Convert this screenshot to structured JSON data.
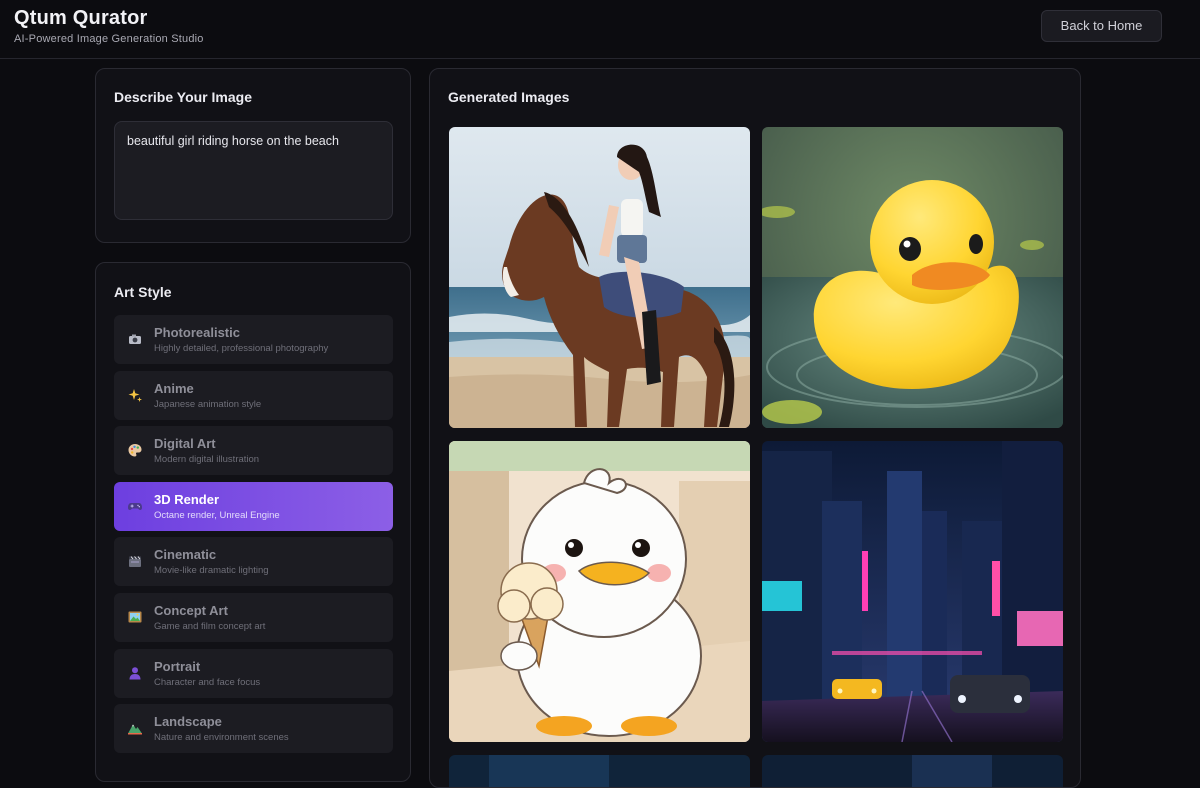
{
  "header": {
    "title": "Qtum Qurator",
    "subtitle": "AI-Powered Image Generation Studio",
    "back_label": "Back to Home"
  },
  "describe": {
    "title": "Describe Your Image",
    "prompt": "beautiful girl riding horse on the beach"
  },
  "art_style": {
    "title": "Art Style",
    "selected": "3D Render",
    "items": [
      {
        "label": "Photorealistic",
        "desc": "Highly detailed, professional photography",
        "icon": "camera-icon"
      },
      {
        "label": "Anime",
        "desc": "Japanese animation style",
        "icon": "sparkles-icon"
      },
      {
        "label": "Digital Art",
        "desc": "Modern digital illustration",
        "icon": "palette-icon"
      },
      {
        "label": "3D Render",
        "desc": "Octane render, Unreal Engine",
        "icon": "game-controller-icon"
      },
      {
        "label": "Cinematic",
        "desc": "Movie-like dramatic lighting",
        "icon": "clapperboard-icon"
      },
      {
        "label": "Concept Art",
        "desc": "Game and film concept art",
        "icon": "framed-picture-icon"
      },
      {
        "label": "Portrait",
        "desc": "Character and face focus",
        "icon": "person-silhouette-icon"
      },
      {
        "label": "Landscape",
        "desc": "Nature and environment scenes",
        "icon": "mountain-icon"
      }
    ]
  },
  "gallery": {
    "title": "Generated Images",
    "images": [
      {
        "subject": "girl riding horse on beach"
      },
      {
        "subject": "yellow rubber duck in water"
      },
      {
        "subject": "cartoon duck holding ice cream"
      },
      {
        "subject": "neon city street at night"
      }
    ]
  },
  "colors": {
    "background": "#0c0c10",
    "panel": "#111116",
    "accent_start": "#6d3fe0",
    "accent_end": "#8c5fe6"
  }
}
